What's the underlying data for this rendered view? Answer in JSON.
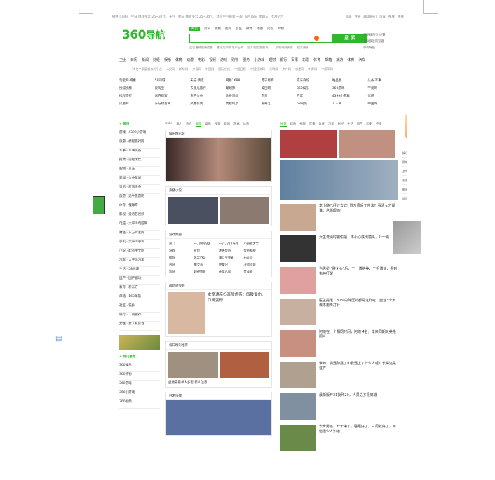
{
  "topbar": {
    "left": [
      "播种 (036)",
      "今日 晴转多云 25~32°C",
      "天气",
      "明日 晴转多云 25~34°C",
      "北京空气质量 一般",
      "8月18日 星期三",
      "七月初六"
    ],
    "right": [
      "登录",
      "注册 (360账号)",
      "设置",
      "换肤",
      "换肤"
    ]
  },
  "logo": {
    "brand": "360",
    "nav": "导航"
  },
  "search_tabs": [
    "网页",
    "资讯",
    "视频",
    "图片",
    "良医",
    "微博",
    "地图",
    "问答",
    "购物"
  ],
  "search": {
    "placeholder": "",
    "button": "搜 索",
    "right_links": [
      "浏览器首页 设置",
      "360极速浏览器",
      "手机导航"
    ]
  },
  "hot": [
    "三伏暑热健康提醒",
    "搬家后如何落户上海",
    "应如何监督解决...",
    "某地政府表态",
    "搜索更多"
  ],
  "main_nav": [
    "卫士",
    "日历",
    "新闻",
    "财经",
    "娱乐",
    "体育",
    "动漫",
    "电影",
    "视频",
    "游戏",
    "购物",
    "服务",
    "小游戏",
    "理财",
    "银行",
    "军事",
    "彩票",
    "体育",
    "邮箱",
    "旅游",
    "体育",
    "汽车"
  ],
  "sub_nav": [
    "36亿个家庭服务的平台",
    "人民网",
    "新华网",
    "央视网",
    "中国网",
    "国际在线",
    "中国日报",
    "中国经济网",
    "光明网",
    "央广网",
    "求是网",
    "中青网",
    "中国军网"
  ],
  "sites": [
    "淘宝网·特惠",
    "58同城",
    "天猫·精选",
    "网易1688",
    "苏宁易购",
    "京东商城",
    "唯品会",
    "头条·军事",
    "搜狐视频",
    "爱淘宝",
    "去哪儿旅行",
    "聚划算",
    "美团网",
    "360娱乐",
    "360游戏",
    "宇视网",
    "携程旅行",
    "东方财富",
    "东方头条",
    "头条新闻",
    "京东",
    "百度",
    "4399小游戏",
    "优酷",
    "凤凰网",
    "东方财富网",
    "凤凰新闻",
    "携程机票",
    "爱奇艺",
    "58同城",
    "人人网",
    "中国网"
  ],
  "left": {
    "head": "+ 常用",
    "rows": [
      "游戏 · 4399小游戏",
      "旅游 · 携程旅行网",
      "军事 · 军事头条",
      "招聘 · 前程无忧",
      "购物 · 京东",
      "新闻 · 头条新闻",
      "资讯 · 新浪头条",
      "旅游 · 途牛旅游网",
      "体育 · 懂球帝",
      "影视 · 爱奇艺视频",
      "电脑 · 太平洋电脑网",
      "财经 · 东方财富网",
      "手机 · 太平洋手机",
      "小说 · 起点中文网",
      "汽车 · 太平洋汽车",
      "生活 · 58同城",
      "国产 · 国产剧场",
      "教育 · 新东方",
      "邮箱 · 163邮箱",
      "社区 · 猫扑",
      "银行 · 工商银行",
      "女性 · 女人私房话"
    ],
    "apps_head": "+ 热门推荐",
    "apps": [
      "360娱乐",
      "360购物",
      "360游戏",
      "360小游戏",
      "360视频"
    ]
  },
  "mid": {
    "tabs": [
      "cube",
      "魔力",
      "热点",
      "推荐",
      "娱乐",
      "视频",
      "新闻",
      "游戏",
      "体育"
    ],
    "card1": "娱乐精彩站",
    "card2": "热播小说",
    "card3": "游戏频道",
    "card3_rows": [
      "热门",
      "一刀9999级",
      "一刀7777光柱",
      "小游戏大全",
      "游戏",
      "冒险",
      "迷失传奇",
      "传奇私服",
      "推荐",
      "风云办公",
      "魂斗罗重置",
      "石头剑",
      "热游",
      "魔灵戒",
      "寻秦记",
      "决战沙城",
      "新游",
      "超神传奇",
      "天龙八部",
      "合成器"
    ],
    "card4": "最新短视频",
    "card4_text": "女童遭亲妈百般虐待：四肢受伤、口鼻变形",
    "card5": "每日精彩推荐",
    "card5_text": "坐地铁看书人多否 新人注意",
    "card6": "好游快爆"
  },
  "feed": {
    "tabs": [
      "推荐",
      "娱乐",
      "视频",
      "军事",
      "体育",
      "汽车",
      "财经",
      "生活",
      "国产",
      "历史",
      "更多"
    ],
    "items": [
      "李小璐已经过去式! 胃万周后于俊泫？看清女方是谁：这弹眼面!",
      "女生洗澡时被偷拍，不小心跌出镜头，吓一跳",
      "当男星 \"胖化头\"后，王一博绝美，于祖博惊，看到韦神吓醒",
      "医生提醒：80%的降压药都是这样吃，坐这3个步骤不用再打针",
      "阿姨在一个相同时间，阿姨 4名，本来同期又美艳照片",
      "谁知：偶遇孙露了和我遇上了什么人呢？长得还是这样",
      "最新版开31批歼20，人员之多很离谱",
      "去世男孩，开干净了，睡眠好了，三周就好了，可惜很少人知道"
    ]
  },
  "side": [
    "娱乐",
    "购物",
    "游戏",
    "彩票",
    "新闻",
    "返回顶部"
  ]
}
